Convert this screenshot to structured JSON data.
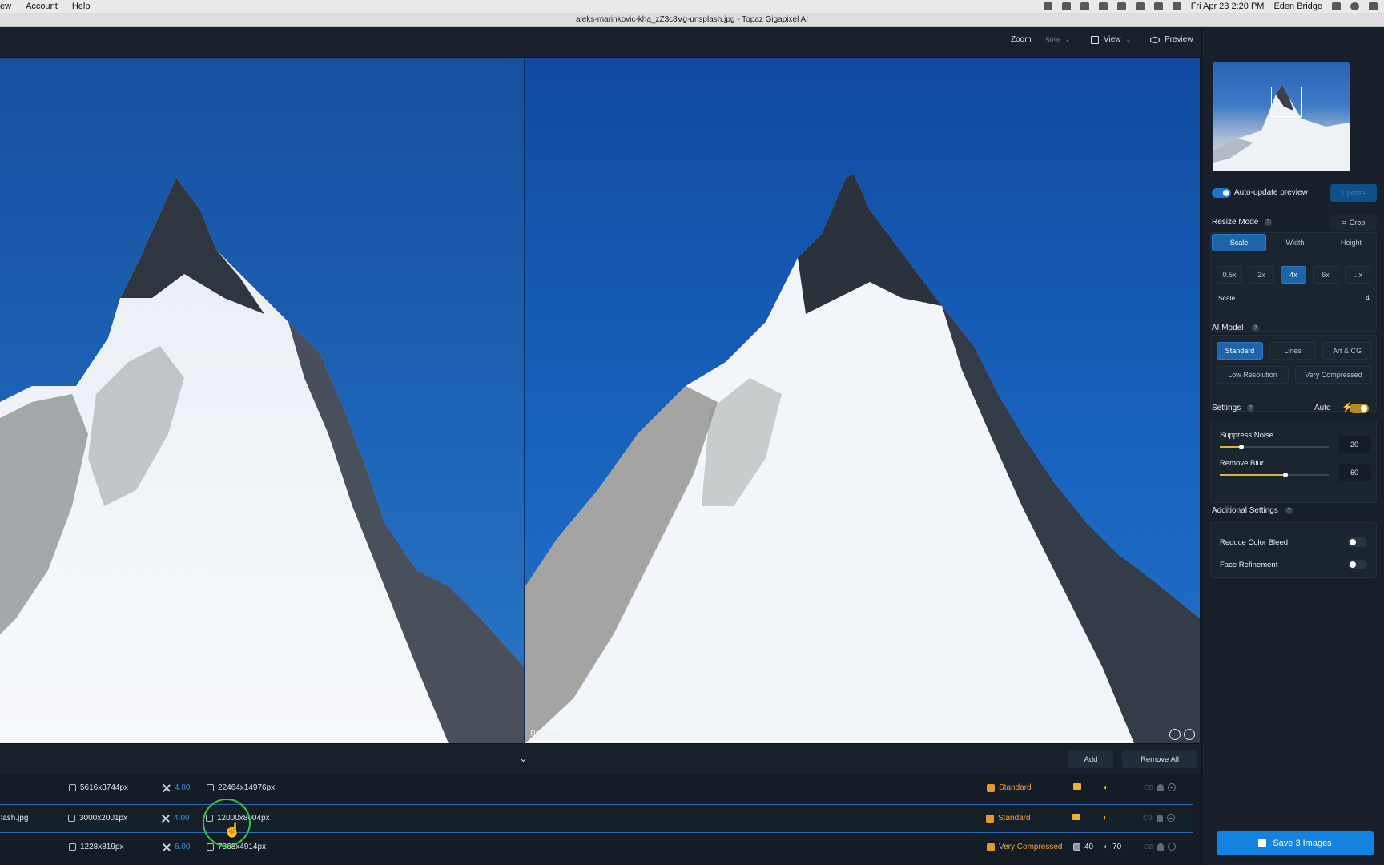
{
  "menubar": {
    "items": [
      "ew",
      "Account",
      "Help"
    ],
    "datetime": "Fri Apr 23  2:20 PM",
    "user": "Eden Bridge"
  },
  "window": {
    "title": "aleks-marinkovic-kha_zZ3c8Vg-unsplash.jpg - Topaz Gigapixel AI"
  },
  "toolbar": {
    "zoom_label": "Zoom",
    "zoom_value": "50%",
    "view_label": "View",
    "preview_label": "Preview"
  },
  "viewer": {
    "preview_tag": "Preview"
  },
  "queue": {
    "add_label": "Add",
    "remove_all_label": "Remove All",
    "rows": [
      {
        "name": "",
        "input": "5616x3744px",
        "scale": "4.00",
        "output": "22464x14976px",
        "model": "Standard",
        "extra1": "",
        "extra2": ""
      },
      {
        "name": "lash.jpg",
        "input": "3000x2001px",
        "scale": "4.00",
        "output": "12000x8004px",
        "model": "Standard",
        "extra1": "",
        "extra2": ""
      },
      {
        "name": "",
        "input": "1228x819px",
        "scale": "6.00",
        "output": "7368x4914px",
        "model": "Very Compressed",
        "extra1": "40",
        "extra2": "70"
      }
    ],
    "cb": "CB"
  },
  "panel": {
    "auto_update_label": "Auto-update preview",
    "update_label": "Update",
    "resize_mode_label": "Resize Mode",
    "crop_label": "Crop",
    "resize_tabs": [
      "Scale",
      "Width",
      "Height"
    ],
    "scale_presets": [
      "0.5x",
      "2x",
      "4x",
      "6x",
      "...x"
    ],
    "scale_label": "Scale",
    "scale_value": "4",
    "ai_model_label": "AI Model",
    "models": [
      "Standard",
      "Lines",
      "Art & CG",
      "Low Resolution",
      "Very Compressed"
    ],
    "settings_label": "Settings",
    "auto_label": "Auto",
    "suppress_noise_label": "Suppress Noise",
    "suppress_noise_value": "20",
    "remove_blur_label": "Remove Blur",
    "remove_blur_value": "60",
    "additional_settings_label": "Additional Settings",
    "reduce_color_bleed_label": "Reduce Color Bleed",
    "face_refinement_label": "Face Refinement",
    "save_label": "Save 3 Images"
  },
  "colors": {
    "accent": "#1482e0",
    "model_orange": "#f0a23a",
    "scale_blue": "#3d8fe0",
    "auto_gold": "#e8b732"
  }
}
